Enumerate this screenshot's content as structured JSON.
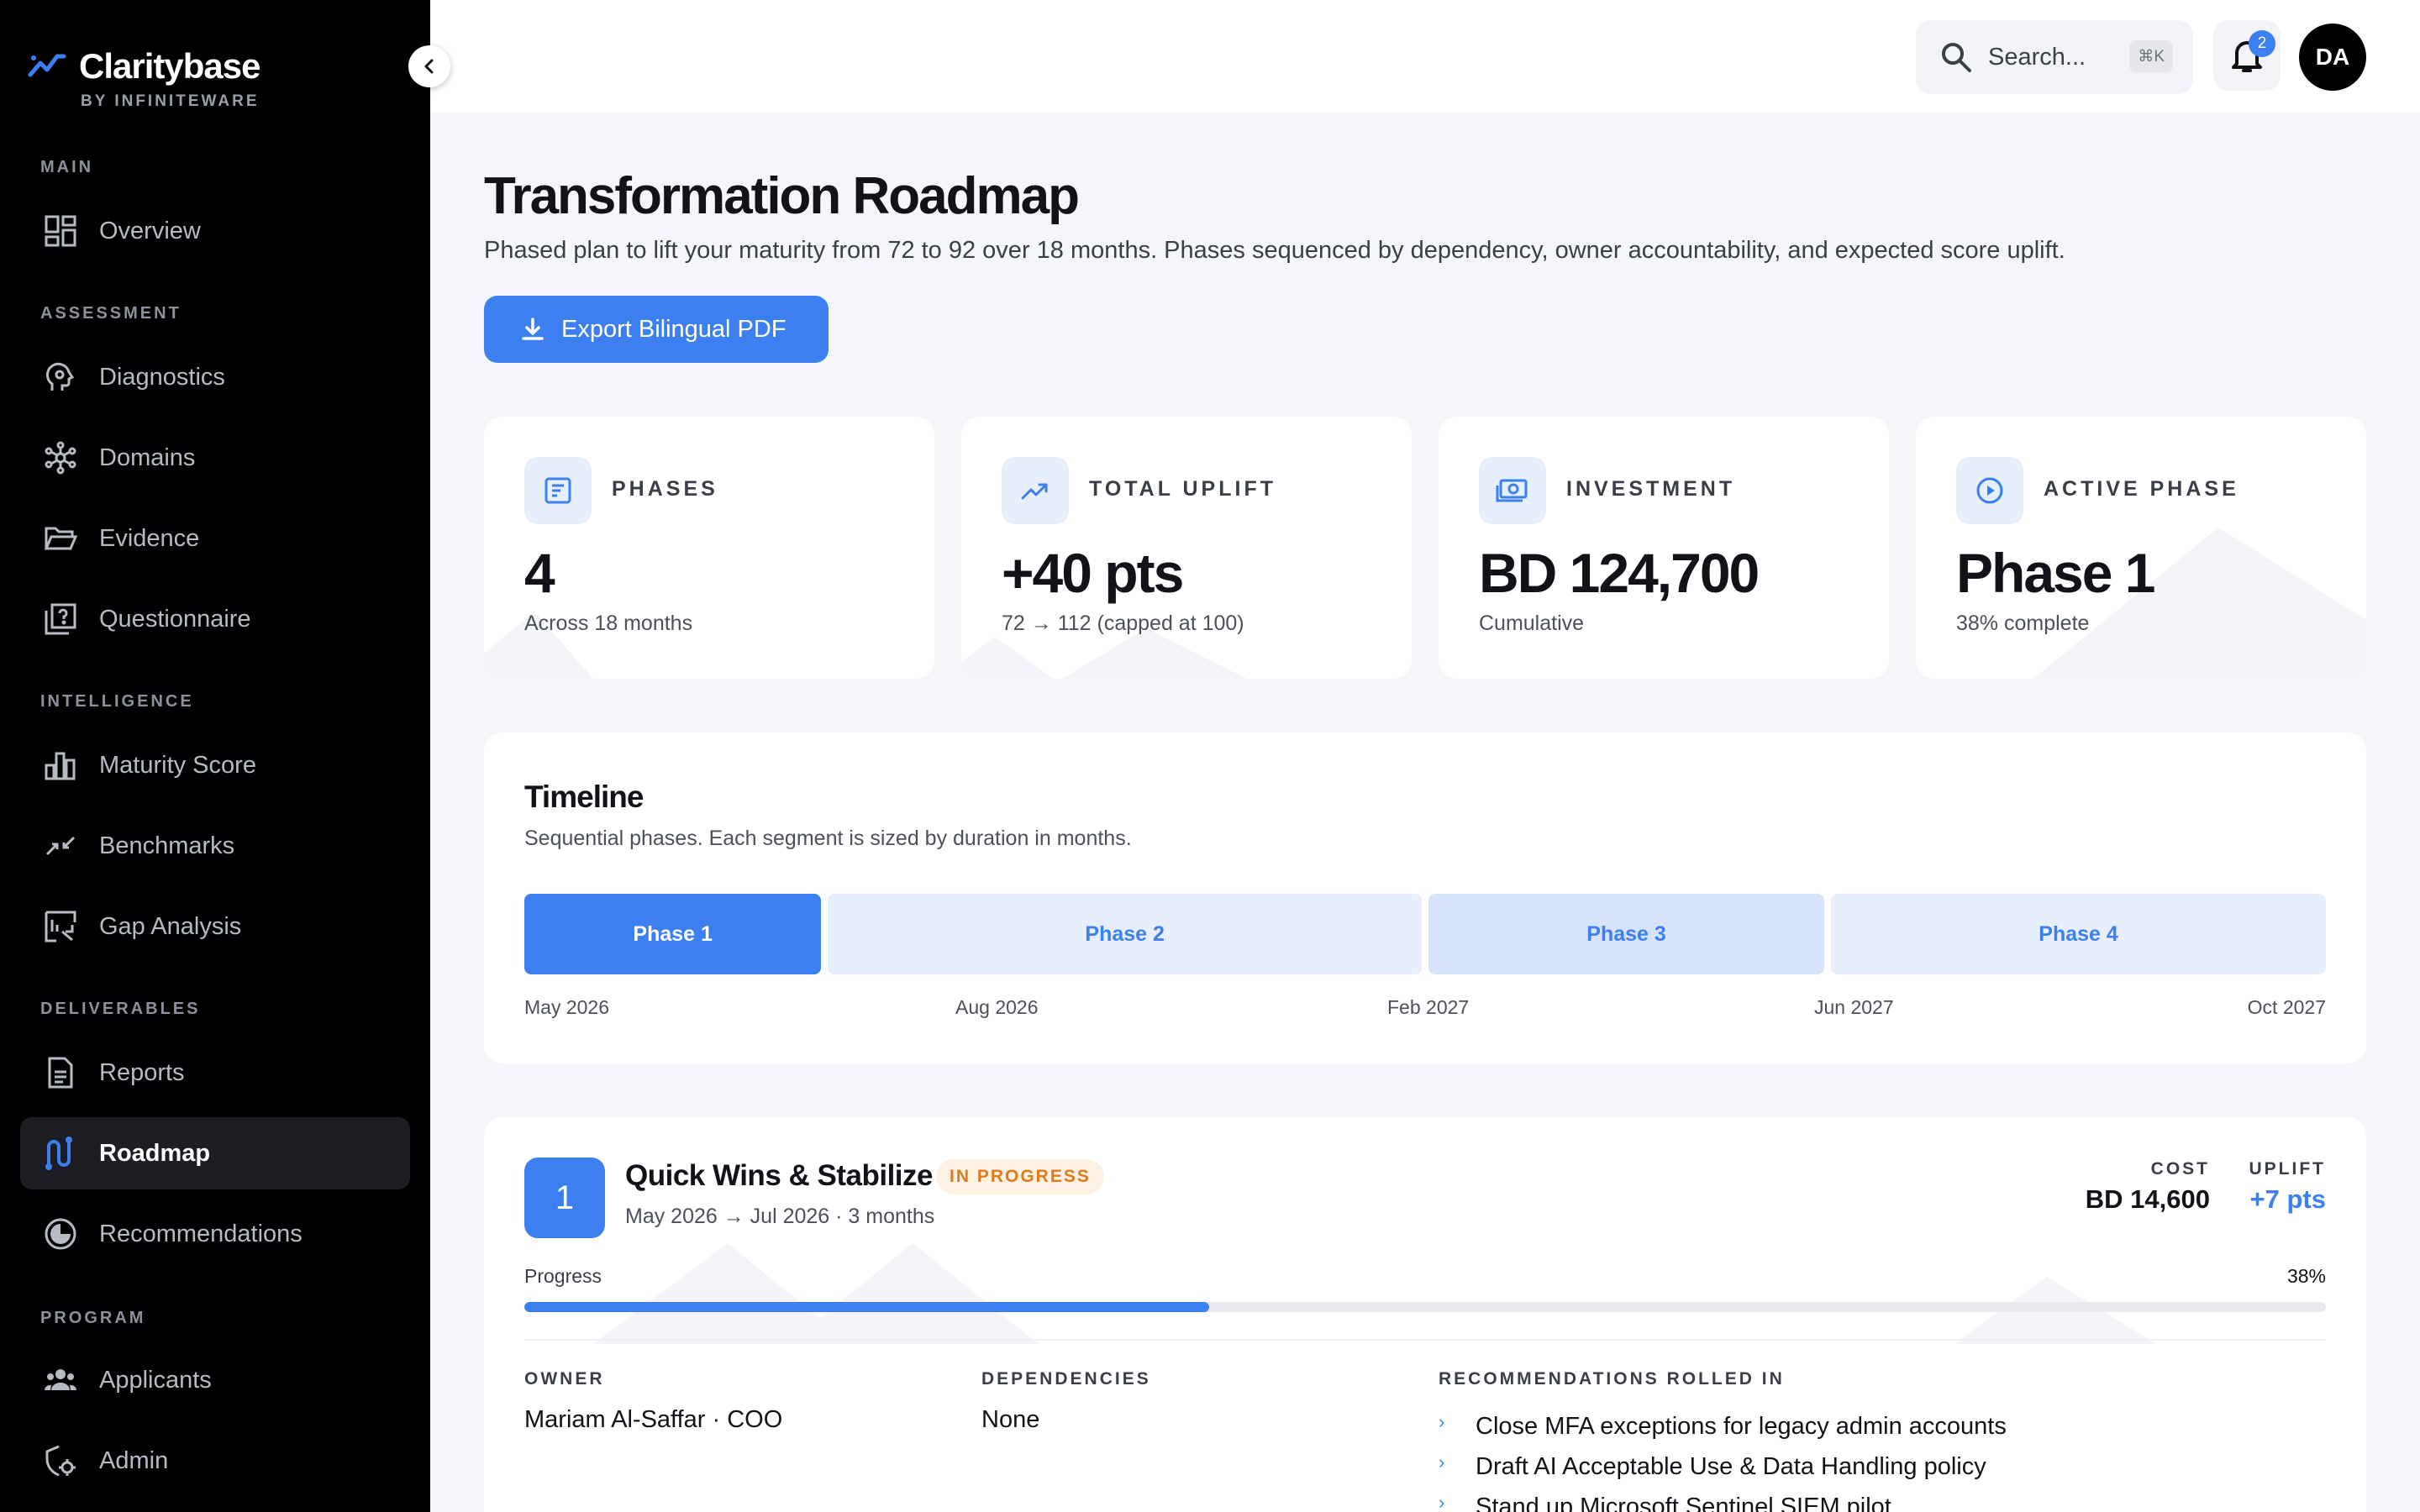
{
  "brand": {
    "name": "Claritybase",
    "sub": "BY INFINITEWARE"
  },
  "sidebar": {
    "sections": [
      {
        "title": "MAIN",
        "items": [
          {
            "label": "Overview",
            "icon": "grid-icon"
          }
        ]
      },
      {
        "title": "ASSESSMENT",
        "items": [
          {
            "label": "Diagnostics",
            "icon": "brain-icon"
          },
          {
            "label": "Domains",
            "icon": "network-icon"
          },
          {
            "label": "Evidence",
            "icon": "folder-icon"
          },
          {
            "label": "Questionnaire",
            "icon": "question-icon"
          }
        ]
      },
      {
        "title": "INTELLIGENCE",
        "items": [
          {
            "label": "Maturity Score",
            "icon": "bar-chart-icon"
          },
          {
            "label": "Benchmarks",
            "icon": "compare-icon"
          },
          {
            "label": "Gap Analysis",
            "icon": "gap-icon"
          }
        ]
      },
      {
        "title": "DELIVERABLES",
        "items": [
          {
            "label": "Reports",
            "icon": "document-icon"
          },
          {
            "label": "Roadmap",
            "icon": "roadmap-icon",
            "active": true
          },
          {
            "label": "Recommendations",
            "icon": "recommend-icon"
          }
        ]
      },
      {
        "title": "PROGRAM",
        "items": [
          {
            "label": "Applicants",
            "icon": "people-icon"
          },
          {
            "label": "Admin",
            "icon": "shield-gear-icon"
          }
        ]
      }
    ]
  },
  "topbar": {
    "search_placeholder": "Search...",
    "shortcut": "⌘K",
    "notifications": "2",
    "avatar": "DA"
  },
  "header": {
    "title": "Transformation Roadmap",
    "description": "Phased plan to lift your maturity from 72 to 92 over 18 months. Phases sequenced by dependency, owner accountability, and expected score uplift.",
    "export_label": "Export Bilingual PDF"
  },
  "stats": [
    {
      "label": "PHASES",
      "value": "4",
      "sub": "Across 18 months",
      "icon": "list-icon"
    },
    {
      "label": "TOTAL UPLIFT",
      "value": "+40 pts",
      "sub": "72 → 112 (capped at 100)",
      "icon": "trend-up-icon"
    },
    {
      "label": "INVESTMENT",
      "value": "BD 124,700",
      "sub": "Cumulative",
      "icon": "money-icon"
    },
    {
      "label": "ACTIVE PHASE",
      "value": "Phase 1",
      "sub": "38% complete",
      "icon": "play-icon"
    }
  ],
  "timeline": {
    "title": "Timeline",
    "description": "Sequential phases. Each segment is sized by duration in months.",
    "phases": [
      {
        "label": "Phase 1",
        "months": 3,
        "active": true
      },
      {
        "label": "Phase 2",
        "months": 6
      },
      {
        "label": "Phase 3",
        "months": 4
      },
      {
        "label": "Phase 4",
        "months": 5
      }
    ],
    "dates": [
      "May 2026",
      "Aug 2026",
      "Feb 2027",
      "Jun 2027",
      "Oct 2027"
    ]
  },
  "phase": {
    "number": "1",
    "title": "Quick Wins & Stabilize",
    "status": "IN PROGRESS",
    "dates": "May 2026 → Jul 2026 · 3 months",
    "cost_label": "COST",
    "cost": "BD 14,600",
    "uplift_label": "UPLIFT",
    "uplift": "+7 pts",
    "progress_label": "Progress",
    "progress_text": "38%",
    "progress": 0.38,
    "owner_label": "OWNER",
    "owner": "Mariam Al-Saffar · COO",
    "dependencies_label": "DEPENDENCIES",
    "dependencies": "None",
    "recs_label": "RECOMMENDATIONS ROLLED IN",
    "recs": [
      "Close MFA exceptions for legacy admin accounts",
      "Draft AI Acceptable Use & Data Handling policy",
      "Stand up Microsoft Sentinel SIEM pilot"
    ]
  },
  "colors": {
    "accent": "#3b7ff0",
    "accent_light": "#e7eefc",
    "badge": "#e07b19",
    "sidebar_bg": "#000000"
  }
}
